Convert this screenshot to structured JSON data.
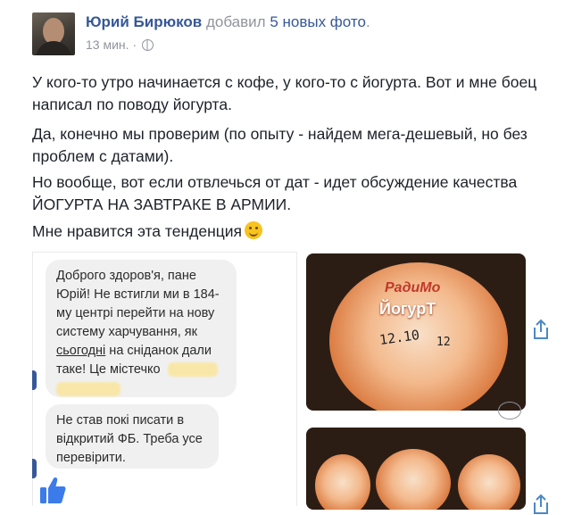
{
  "post": {
    "author": "Юрий Бирюков",
    "action_prefix": " добавил ",
    "action_link": "5 новых фото",
    "action_suffix": ".",
    "timestamp": "13 мин.",
    "paragraphs": [
      "У кого-то утро начинается с кофе, у кого-то с йогурта. Вот и мне боец написал по поводу йогурта.",
      "Да, конечно мы проверим (по опыту - найдем мега-дешевый, но без проблем с датами).",
      "Но вообще, вот если отвлечься от дат - идет обсуждение качества ЙОГУРТА НА ЗАВТРАКЕ В АРМИИ.",
      "Мне нравится эта тенденция"
    ]
  },
  "chat": {
    "message1_part1": "Доброго здоров'я, пане Юрій! Не встигли ми в 184-му центрі перейти на нову систему харчування, як ",
    "message1_underlined": "сьогодні",
    "message1_part2": " на сніданок дали таке! Це містечко",
    "message2": "Не став покі писати в відкритий ФБ. Треба усе перевірити."
  },
  "photos": {
    "label_brand": "РадиМо",
    "label_product": "ЙогурТ",
    "label_date": "12.10",
    "label_lot": "12"
  },
  "colors": {
    "link": "#365899",
    "meta": "#90949c",
    "text": "#1d2129",
    "bubble": "#f1f0f0"
  },
  "icons": [
    "globe-icon",
    "smile-emoji-icon",
    "thumbs-up-icon",
    "share-icon",
    "add-reaction-icon"
  ]
}
